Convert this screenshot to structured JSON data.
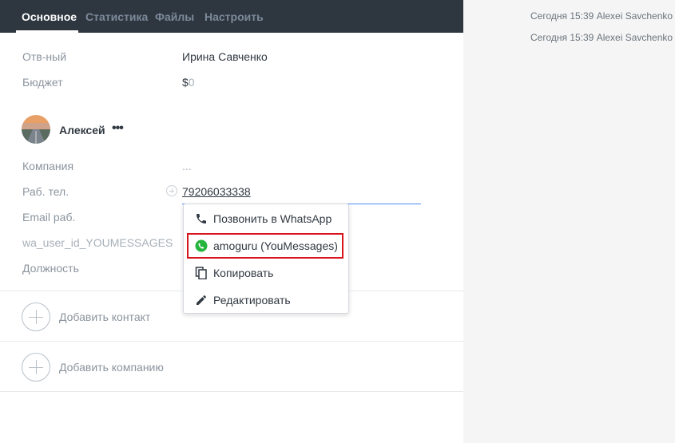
{
  "tabs": [
    {
      "label": "Основное",
      "active": true
    },
    {
      "label": "Статистика",
      "active": false
    },
    {
      "label": "Файлы",
      "active": false
    },
    {
      "label": "Настроить",
      "active": false
    }
  ],
  "lead": {
    "responsible_label": "Отв-ный",
    "responsible_value": "Ирина Савченко",
    "budget_label": "Бюджет",
    "budget_currency": "$",
    "budget_value": "0"
  },
  "contact": {
    "name": "Алексей",
    "more": "•••",
    "fields": {
      "company_label": "Компания",
      "company_value": "...",
      "work_phone_label": "Раб. тел.",
      "work_phone_value": "79206033338",
      "work_email_label": "Email раб.",
      "wa_user_label": "wa_user_id_YOUMESSAGES",
      "position_label": "Должность"
    }
  },
  "phone_menu": {
    "items": [
      {
        "label": "Позвонить в WhatsApp",
        "icon": "phone-icon"
      },
      {
        "label": "amoguru (YouMessages)",
        "icon": "whatsapp-icon",
        "highlighted": true
      },
      {
        "label": "Копировать",
        "icon": "copy-icon"
      },
      {
        "label": "Редактировать",
        "icon": "pencil-icon"
      }
    ]
  },
  "actions": {
    "add_contact": "Добавить контакт",
    "add_company": "Добавить компанию"
  },
  "feed": [
    {
      "text": "Сегодня 15:39 Alexei Savchenko"
    },
    {
      "text": "Сегодня 15:39 Alexei Savchenko"
    }
  ],
  "colors": {
    "tabbar_bg": "#2e3640",
    "highlight_border": "#d8141c",
    "whatsapp_green": "#25b43c",
    "link_blue": "#4c8bf7"
  }
}
